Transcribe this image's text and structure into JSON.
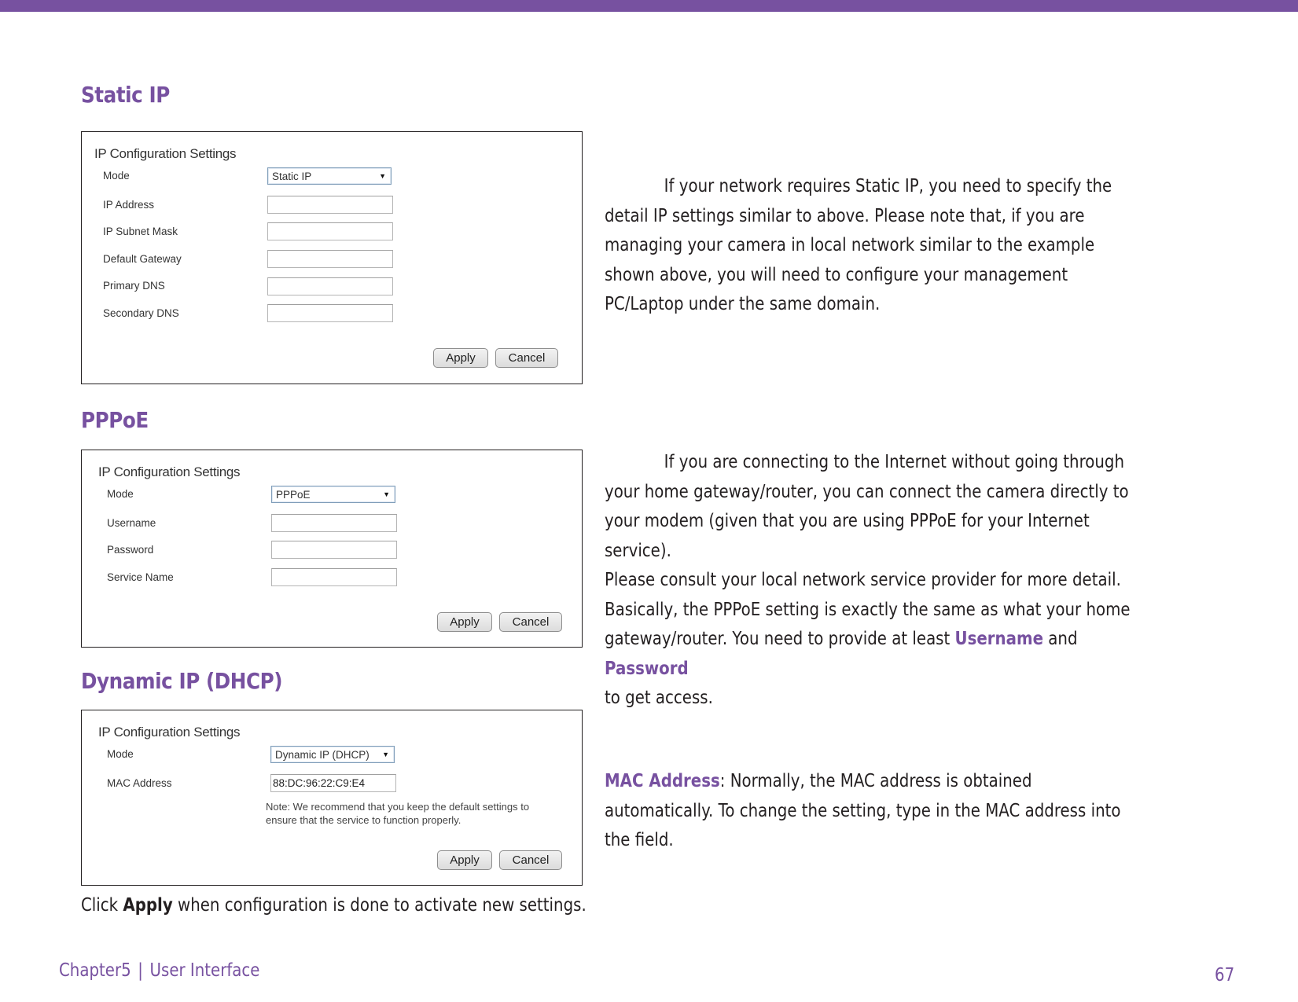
{
  "page": {
    "accent_color": "#7751A0"
  },
  "sections": {
    "static_ip": {
      "title": "Static IP",
      "panel": {
        "title": "IP Configuration Settings",
        "mode_label": "Mode",
        "mode_value": "Static IP",
        "fields": [
          {
            "label": "IP Address",
            "value": ""
          },
          {
            "label": "IP Subnet Mask",
            "value": ""
          },
          {
            "label": "Default Gateway",
            "value": ""
          },
          {
            "label": "Primary DNS",
            "value": ""
          },
          {
            "label": "Secondary DNS",
            "value": ""
          }
        ],
        "apply_label": "Apply",
        "cancel_label": "Cancel"
      },
      "description": "If your network requires Static IP, you need to specify the detail IP settings similar to above. Please note that, if you are managing your camera in local network similar to the example shown above, you will need to configure your management PC/Laptop under the same domain."
    },
    "pppoe": {
      "title": "PPPoE",
      "panel": {
        "title": "IP Configuration Settings",
        "mode_label": "Mode",
        "mode_value": "PPPoE",
        "fields": [
          {
            "label": "Username",
            "value": ""
          },
          {
            "label": "Password",
            "value": ""
          },
          {
            "label": "Service Name",
            "value": ""
          }
        ],
        "apply_label": "Apply",
        "cancel_label": "Cancel"
      },
      "description_lines": [
        "If you are connecting to the Internet without going through",
        "your home gateway/router, you can connect the camera directly to",
        "your modem (given that you are using PPPoE for your Internet service).",
        "Please consult your local network service provider for more detail.",
        "Basically, the PPPoE setting is exactly the same as what your home"
      ],
      "description_tail_prefix": "gateway/router. You need to provide at least ",
      "highlight_username": "Username",
      "description_tail_and": " and ",
      "highlight_password": "Password",
      "description_tail_end": "to get access."
    },
    "dhcp": {
      "title": "Dynamic IP (DHCP)",
      "panel": {
        "title": "IP Configuration Settings",
        "mode_label": "Mode",
        "mode_value": "Dynamic IP (DHCP)",
        "mac_label": "MAC Address",
        "mac_value": "88:DC:96:22:C9:E4",
        "note": "Note: We recommend that you keep the default settings to ensure that the service to function properly.",
        "apply_label": "Apply",
        "cancel_label": "Cancel"
      },
      "description_highlight": "MAC Address",
      "description_rest": ": Normally, the MAC address is obtained automatically. To change the setting, type in the MAC address into the field."
    }
  },
  "bottom_note": {
    "prefix": "Click ",
    "bold": "Apply",
    "suffix": " when configuration is done to activate new settings."
  },
  "footer": {
    "chapter": "Chapter5",
    "separator": "|",
    "section": "User Interface",
    "page_number": "67"
  }
}
